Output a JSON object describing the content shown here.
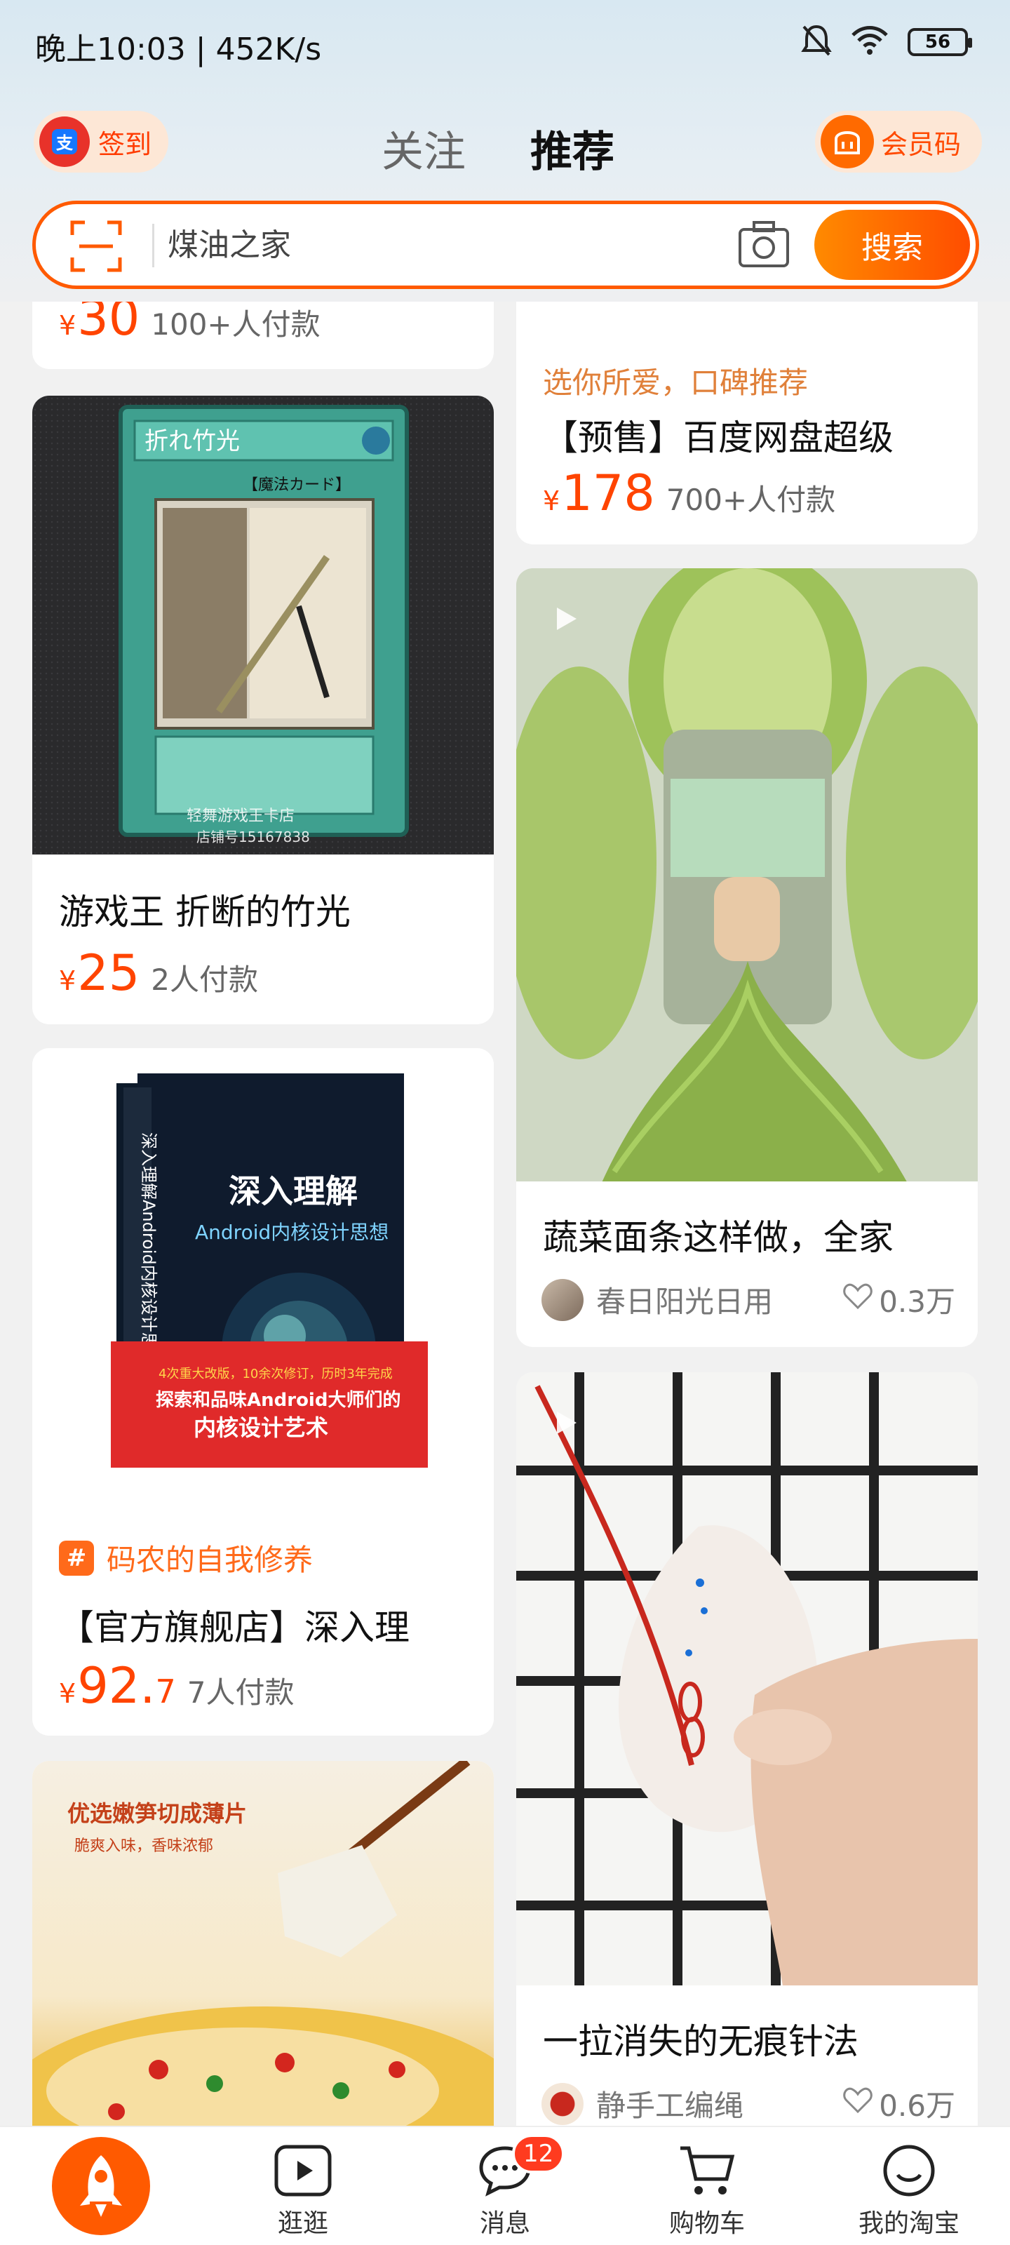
{
  "status_bar": {
    "time_speed": "晚上10:03 | 452K/s",
    "battery": "56"
  },
  "header": {
    "signin_label": "签到",
    "tabs": [
      {
        "label": "关注"
      },
      {
        "label": "推荐"
      }
    ],
    "member_label": "会员码"
  },
  "search": {
    "placeholder": "煤油之家",
    "button_label": "搜索"
  },
  "feed": {
    "left": [
      {
        "price_int": "30",
        "sold": "100+人付款"
      },
      {
        "title": "游戏王 折断的竹光",
        "price_int": "25",
        "sold": "2人付款",
        "image_text": {
          "card_name": "折れ竹光",
          "card_type": "【魔法カード】",
          "watermark_1": "轻舞游戏王卡店",
          "watermark_2": "店铺号15167838"
        }
      },
      {
        "tag": "码农的自我修养",
        "title": "【官方旗舰店】深入理",
        "price_int": "92.",
        "price_dec": "7",
        "sold": "7人付款",
        "image_text": {
          "book_title": "深入理解",
          "book_subtitle": "Android内核设计思想",
          "banner_1": "4次重大改版，10余次修订，历时3年完成",
          "banner_2": "探索和品味Android大师们的",
          "banner_3": "内核设计艺术",
          "spine": "深入理解Android内核设计思想"
        }
      },
      {
        "image_text": {
          "line_1": "优选嫩笋切成薄片",
          "line_2": "脆爽入味，香味浓郁"
        }
      }
    ],
    "right": [
      {
        "tagline": "选你所爱，口碑推荐",
        "title": "【预售】百度网盘超级",
        "price_int": "178",
        "sold": "700+人付款"
      },
      {
        "title": "蔬菜面条这样做，全家",
        "author": "春日阳光日用",
        "likes": "0.3万"
      },
      {
        "title": "一拉消失的无痕针法",
        "author": "静手工编绳",
        "likes": "0.6万"
      }
    ]
  },
  "bottom_nav": {
    "items": [
      {
        "label": ""
      },
      {
        "label": "逛逛"
      },
      {
        "label": "消息"
      },
      {
        "label": "购物车"
      },
      {
        "label": "我的淘宝"
      }
    ],
    "message_badge": "12"
  },
  "colors": {
    "accent": "#ff5a00",
    "price": "#ff4400"
  },
  "icons": [
    "alipay-icon",
    "bell-muted-icon",
    "wifi-icon",
    "battery-icon",
    "scan-icon",
    "camera-icon",
    "play-icon",
    "heart-icon",
    "rocket-icon",
    "video-icon",
    "chat-icon",
    "cart-icon",
    "smile-icon"
  ]
}
